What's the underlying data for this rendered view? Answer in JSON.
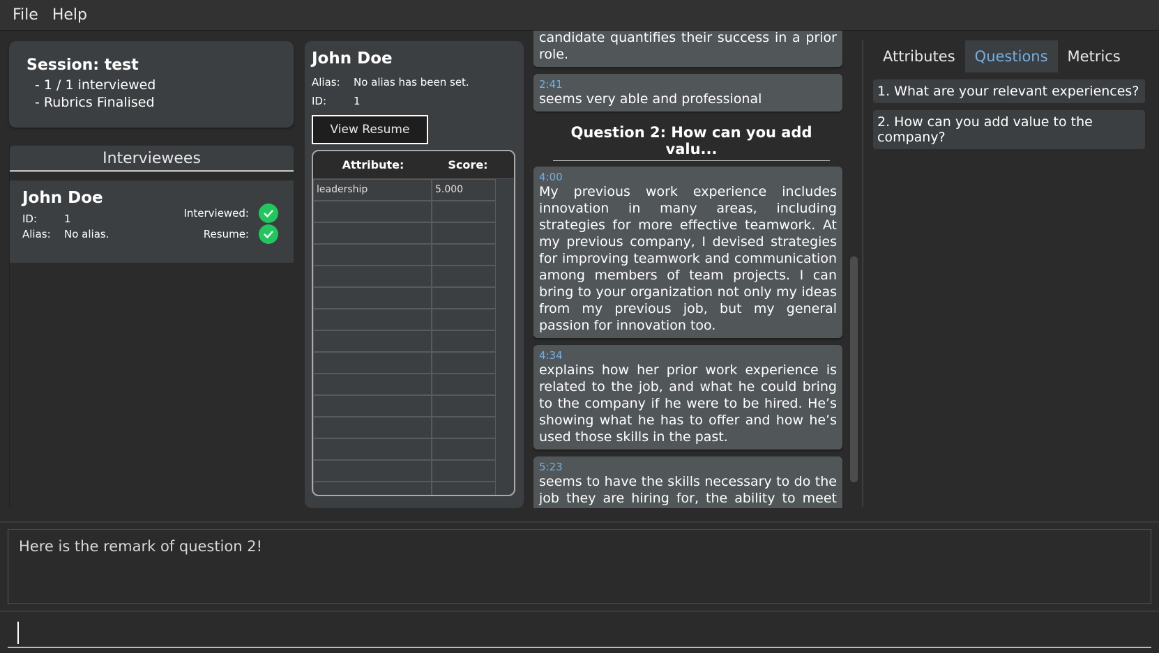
{
  "menu": {
    "file": "File",
    "help": "Help"
  },
  "session": {
    "title": "Session: test",
    "interviewed": "- 1 / 1 interviewed",
    "rubrics": "- Rubrics Finalised"
  },
  "interviewees": {
    "header": "Interviewees",
    "items": [
      {
        "name": "John Doe",
        "id_label": "ID:",
        "id": "1",
        "alias_label": "Alias:",
        "alias": "No alias.",
        "interviewed_label": "Interviewed:",
        "resume_label": "Resume:"
      }
    ]
  },
  "detail": {
    "name": "John Doe",
    "alias_label": "Alias:",
    "alias": "No alias has been set.",
    "id_label": "ID:",
    "id": "1",
    "view_resume": "View Resume",
    "table": {
      "attribute_header": "Attribute:",
      "score_header": "Score:",
      "rows": [
        {
          "attribute": "leadership",
          "score": "5.000"
        }
      ]
    }
  },
  "transcript": {
    "top_fragment": "candidate quantifies their success in a prior role.",
    "note1": {
      "time": "2:41",
      "text": "seems very able and professional"
    },
    "question_heading": "Question 2: How can you add valu...",
    "note2": {
      "time": "4:00",
      "text": "My previous work experience includes innovation in many areas, including strategies for more effective teamwork. At my previous company, I devised strategies for improving teamwork and communication among members of team projects. I can bring to your organization not only my ideas from my previous job, but my general passion for innovation too."
    },
    "note3": {
      "time": "4:34",
      "text": "explains how her prior work experience is related to the job, and what he could bring to the company if he were to be hired. He’s showing what he has to offer and how he’s used those skills in the past."
    },
    "note4": {
      "time": "5:23",
      "text": "seems to have the skills necessary to do the job they are hiring for, the ability to meet challenges"
    }
  },
  "tabs": {
    "attributes": "Attributes",
    "questions": "Questions",
    "metrics": "Metrics"
  },
  "questions": [
    "1. What are your relevant experiences?",
    "2. How can you add value to the company?"
  ],
  "remark": "Here is the remark of question 2!",
  "colors": {
    "accent": "#72b0e6",
    "check": "#22c55e",
    "background": "#2b2b2b",
    "panel": "#3c3f41"
  }
}
